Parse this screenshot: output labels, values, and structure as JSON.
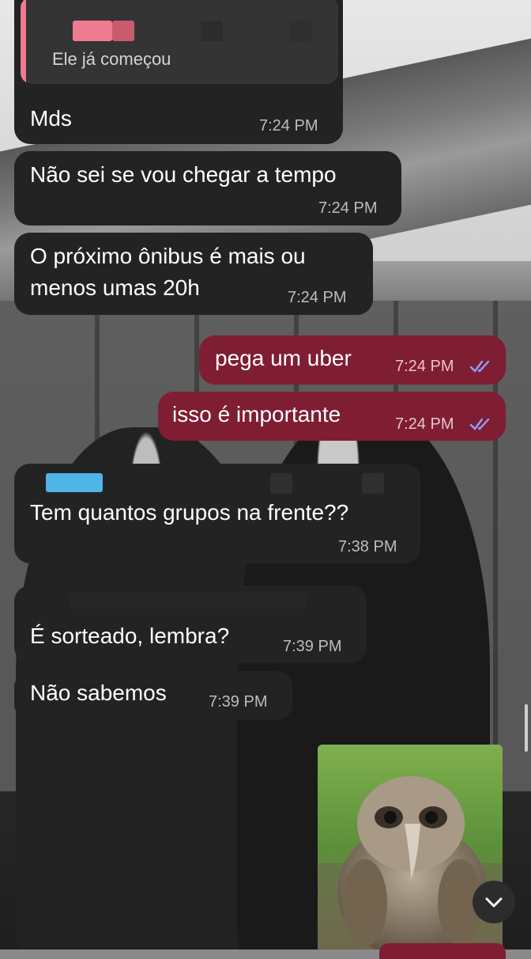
{
  "messages": [
    {
      "text": "Mds",
      "time": "7:24 PM",
      "reply_preview": "Ele já começou"
    },
    {
      "text": "Não sei se vou chegar a tempo",
      "time": "7:24 PM"
    },
    {
      "text_line1": "O próximo ônibus é mais ou",
      "text_line2": "menos umas 20h",
      "time": "7:24 PM"
    },
    {
      "text": "pega um uber",
      "time": "7:24 PM"
    },
    {
      "text": "isso é importante",
      "time": "7:24 PM"
    },
    {
      "text": "Tem quantos grupos na frente??",
      "time": "7:38 PM"
    },
    {
      "text": "É sorteado, lembra?",
      "time": "7:39 PM"
    },
    {
      "text": "Não sabemos",
      "time": "7:39 PM"
    }
  ],
  "icons": {
    "read_receipt": "double-check-icon",
    "scroll_down": "chevron-down-icon"
  },
  "colors": {
    "incoming_bubble": "#232323",
    "outgoing_bubble": "#7f1d33",
    "read_check": "#8fa0ff",
    "reply_bar": "#f07a8f"
  }
}
